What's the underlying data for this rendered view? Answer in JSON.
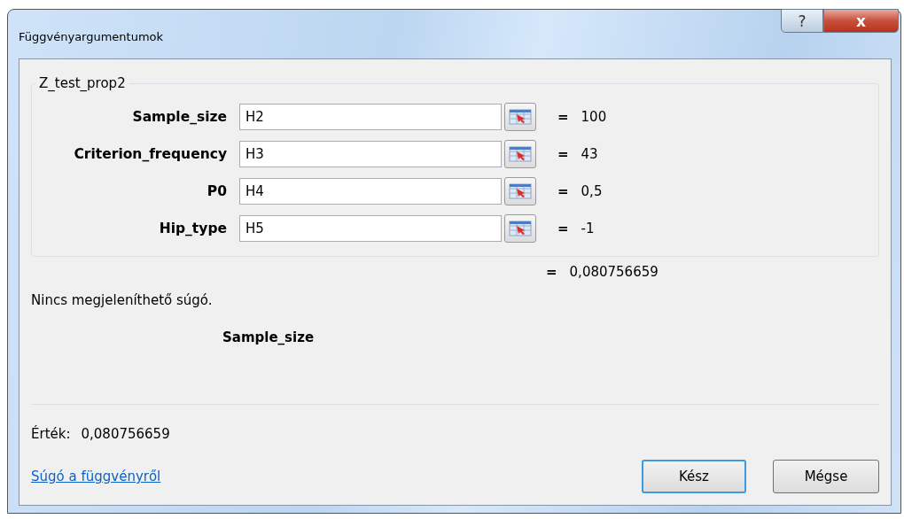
{
  "window": {
    "title": "Függvényargumentumok",
    "controls": [
      "?",
      "x"
    ]
  },
  "group": {
    "title": "Z_test_prop2",
    "arguments": [
      {
        "label": "Sample_size",
        "value": "H2",
        "result": "100"
      },
      {
        "label": "Criterion_frequency",
        "value": "H3",
        "result": "43"
      },
      {
        "label": "P0",
        "value": "H4",
        "result": "0,5"
      },
      {
        "label": "Hip_type",
        "value": "H5",
        "result": "-1"
      }
    ]
  },
  "formula_result": "0,080756659",
  "equals": "=",
  "help_text": "Nincs megjeleníthető súgó.",
  "argument_name": "Sample_size",
  "value_label": "Érték:",
  "value": "0,080756659",
  "help_link": "Súgó a függvényről",
  "buttons": [
    {
      "label": "Kész",
      "default": true
    },
    {
      "label": "Mégse",
      "default": false
    }
  ]
}
